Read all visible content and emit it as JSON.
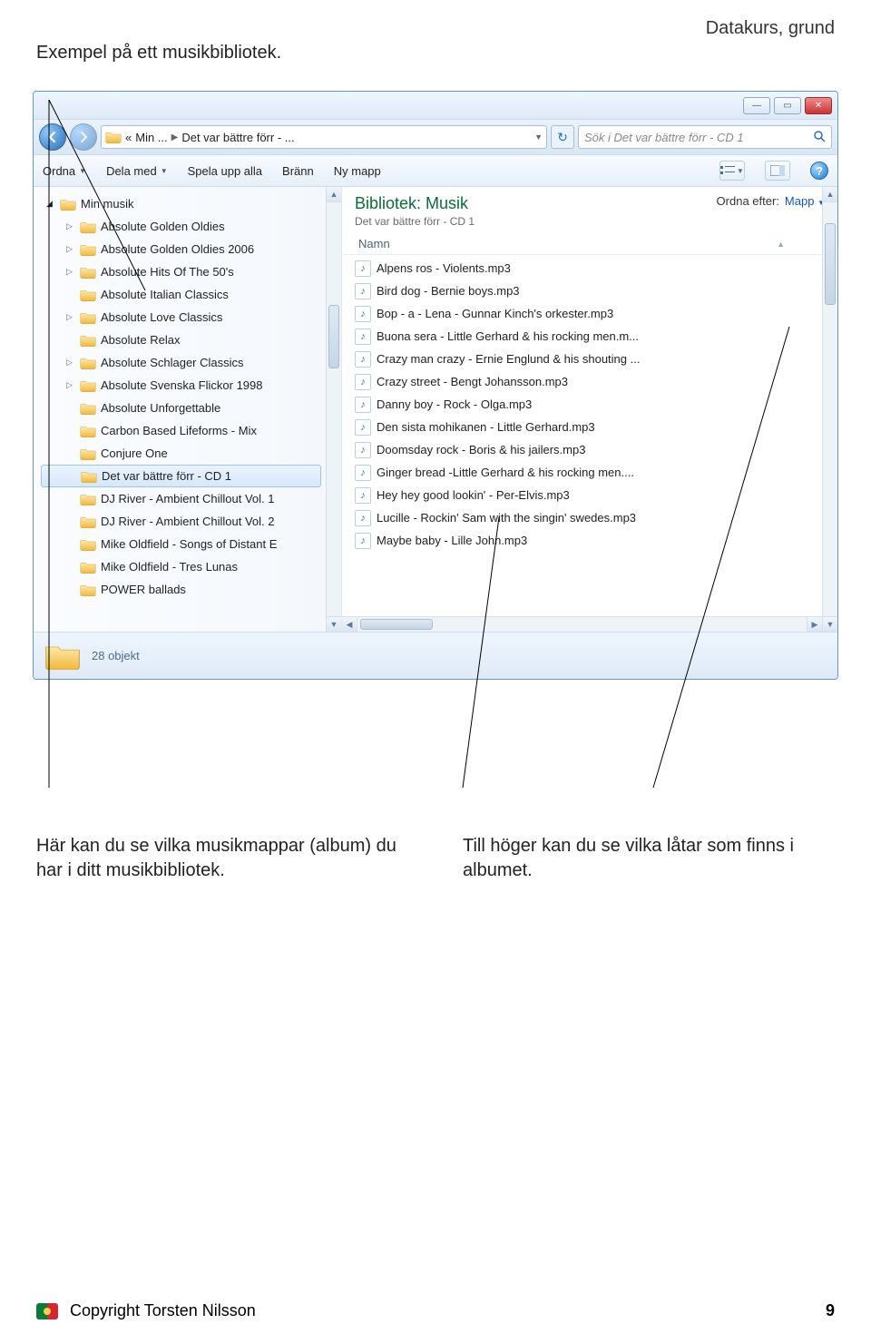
{
  "doc": {
    "header_right": "Datakurs, grund",
    "title": "Exempel på ett musikbibliotek.",
    "callout_left": "Här kan du se vilka musikmap­par (album) du har i ditt musik­bibliotek.",
    "callout_right": "Till höger kan du se vilka låtar som finns i albumet.",
    "footer": "Copyright Torsten Nilsson",
    "page_number": "9"
  },
  "win": {
    "breadcrumb": {
      "chev": "«",
      "p1": "Min ...",
      "p2": "Det var bättre förr - ..."
    },
    "search_placeholder": "Sök i Det var bättre förr - CD 1",
    "toolbar": {
      "organize": "Ordna",
      "share": "Dela med",
      "play_all": "Spela upp alla",
      "burn": "Bränn",
      "new_folder": "Ny mapp"
    },
    "tree_root": "Min musik",
    "tree": [
      {
        "label": "Absolute Golden Oldies",
        "tri": "closed"
      },
      {
        "label": "Absolute Golden Oldies 2006",
        "tri": "closed"
      },
      {
        "label": "Absolute Hits Of The 50's",
        "tri": "closed"
      },
      {
        "label": "Absolute Italian Classics",
        "tri": "none"
      },
      {
        "label": "Absolute Love Classics",
        "tri": "closed"
      },
      {
        "label": "Absolute Relax",
        "tri": "none"
      },
      {
        "label": "Absolute Schlager Classics",
        "tri": "closed"
      },
      {
        "label": "Absolute Svenska Flickor 1998",
        "tri": "closed"
      },
      {
        "label": "Absolute Unforgettable",
        "tri": "none"
      },
      {
        "label": "Carbon Based Lifeforms - Mix",
        "tri": "none"
      },
      {
        "label": "Conjure One",
        "tri": "none"
      },
      {
        "label": "Det var bättre förr - CD 1",
        "tri": "none",
        "selected": true
      },
      {
        "label": "DJ River - Ambient Chillout Vol. 1",
        "tri": "none"
      },
      {
        "label": "DJ River - Ambient Chillout Vol. 2",
        "tri": "none"
      },
      {
        "label": "Mike Oldfield - Songs of Distant E",
        "tri": "none"
      },
      {
        "label": "Mike Oldfield - Tres Lunas",
        "tri": "none"
      },
      {
        "label": "POWER ballads",
        "tri": "none"
      }
    ],
    "library_title": "Bibliotek: Musik",
    "library_sub": "Det var bättre förr - CD 1",
    "sort_label": "Ordna efter:",
    "sort_value": "Mapp",
    "column_name": "Namn",
    "files": [
      "Alpens ros - Violents.mp3",
      "Bird dog - Bernie boys.mp3",
      "Bop - a - Lena - Gunnar Kinch's orkester.mp3",
      "Buona sera - Little Gerhard & his rocking men.m...",
      "Crazy man crazy - Ernie Englund & his shouting ...",
      "Crazy street - Bengt Johansson.mp3",
      "Danny boy - Rock - Olga.mp3",
      "Den sista mohikanen - Little Gerhard.mp3",
      "Doomsday rock  - Boris & his jailers.mp3",
      "Ginger bread -Little Gerhard & his rocking men....",
      "Hey hey good lookin' - Per-Elvis.mp3",
      "Lucille - Rockin' Sam with the singin' swedes.mp3",
      "Maybe baby - Lille John.mp3"
    ],
    "status_count": "28 objekt"
  }
}
